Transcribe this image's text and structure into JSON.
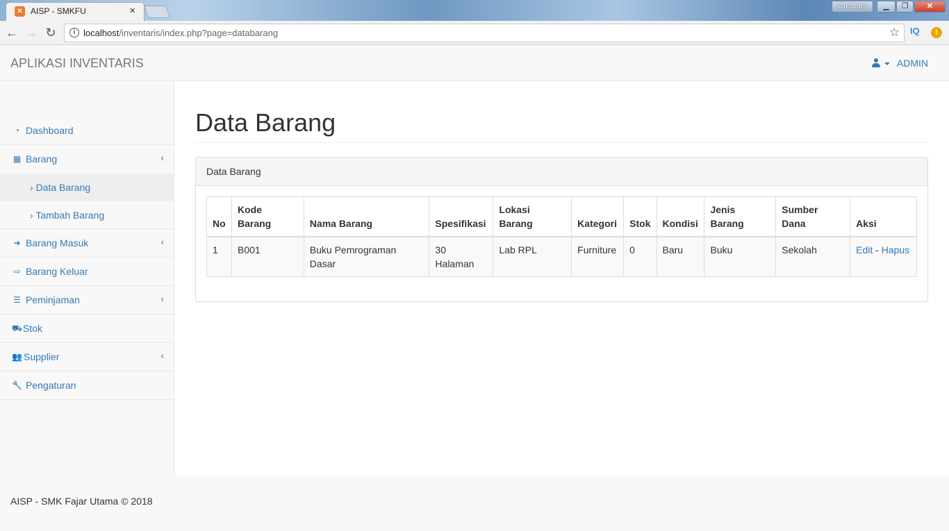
{
  "browser": {
    "tab_title": "AISP - SMKFU",
    "tab_close": "×",
    "url_host": "localhost",
    "url_path": "/inventaris/index.php?page=databarang",
    "creators_label": "Creators",
    "ext_iq": "IQ",
    "ext_warn": "!"
  },
  "navbar": {
    "brand": "APLIKASI INVENTARIS",
    "user_label": "ADMIN"
  },
  "sidebar": {
    "items": [
      {
        "label": "Dashboard",
        "icon": "dashboard-icon"
      },
      {
        "label": "Barang",
        "icon": "qrcode-icon",
        "chevron": "‹"
      },
      {
        "label": "Barang Masuk",
        "icon": "sign-in-icon",
        "chevron": "‹"
      },
      {
        "label": "Barang Keluar",
        "icon": "sign-out-icon"
      },
      {
        "label": "Peminjaman",
        "icon": "list-icon",
        "chevron": "‹"
      },
      {
        "label": "Stok",
        "icon": "truck-icon"
      },
      {
        "label": "Supplier",
        "icon": "users-icon",
        "chevron": "‹"
      },
      {
        "label": "Pengaturan",
        "icon": "wrench-icon"
      }
    ],
    "sub_items": [
      {
        "label": "Data Barang"
      },
      {
        "label": "Tambah Barang"
      }
    ],
    "sub_marker": "›"
  },
  "main": {
    "page_title": "Data Barang",
    "panel_heading": "Data Barang",
    "table": {
      "headers": [
        "No",
        "Kode Barang",
        "Nama Barang",
        "Spesifikasi",
        "Lokasi Barang",
        "Kategori",
        "Stok",
        "Kondisi",
        "Jenis Barang",
        "Sumber Dana",
        "Aksi"
      ],
      "rows": [
        {
          "no": "1",
          "kode": "B001",
          "nama": "Buku Pemrograman Dasar",
          "spesifikasi": "30 Halaman",
          "lokasi": "Lab RPL",
          "kategori": "Furniture",
          "stok": "0",
          "kondisi": "Baru",
          "jenis": "Buku",
          "sumber": "Sekolah",
          "edit": "Edit",
          "sep": " - ",
          "hapus": "Hapus"
        }
      ]
    }
  },
  "footer": {
    "text": "AISP - SMK Fajar Utama © 2018"
  },
  "colors": {
    "link": "#337ab7",
    "navbar_bg": "#f8f8f8",
    "panel_heading_bg": "#f5f5f5"
  }
}
